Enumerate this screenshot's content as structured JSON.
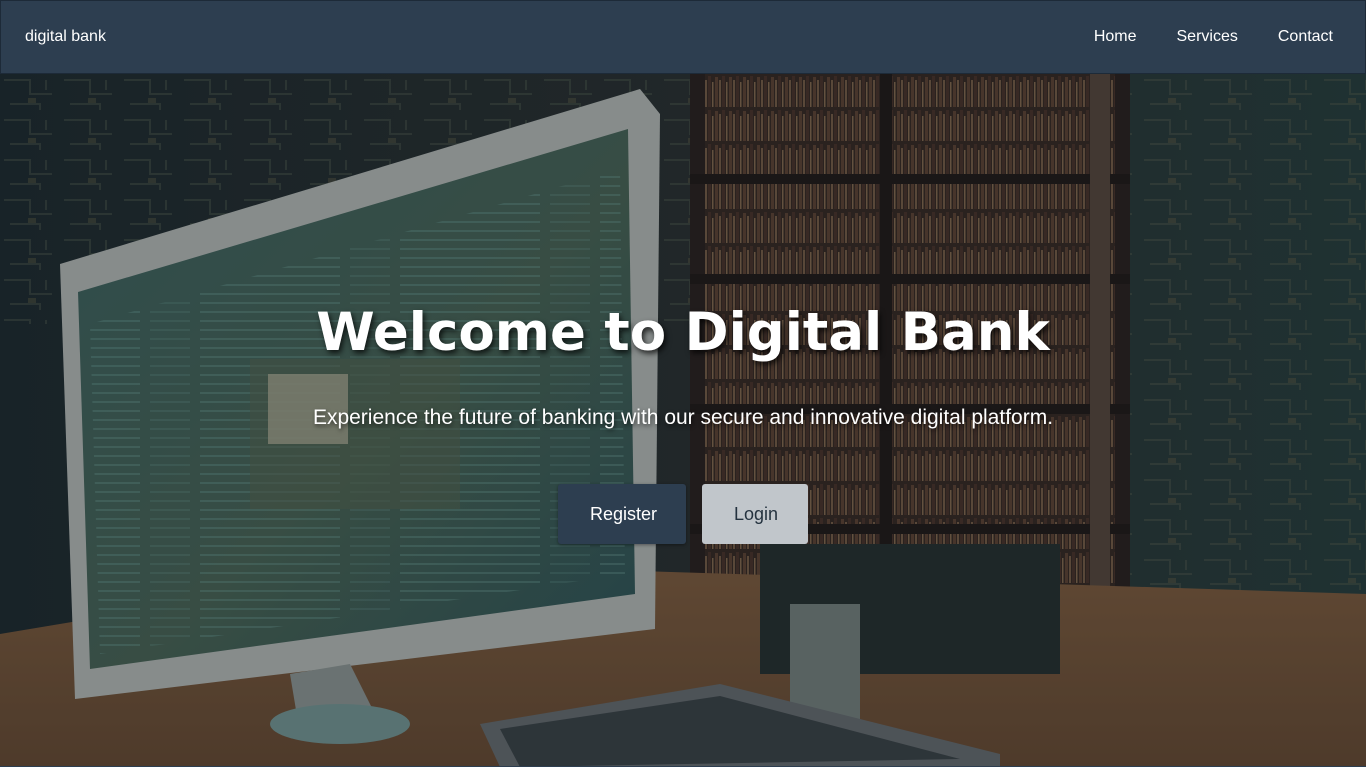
{
  "navbar": {
    "brand": "digital bank",
    "links": [
      {
        "label": "Home"
      },
      {
        "label": "Services"
      },
      {
        "label": "Contact"
      }
    ]
  },
  "hero": {
    "title": "Welcome to Digital Bank",
    "subtitle": "Experience the future of banking with our secure and innovative digital platform.",
    "register_label": "Register",
    "login_label": "Login",
    "background_image": "illustration of a desktop computer monitor and keyboard on a desk in front of a wall of bookshelves and circuit patterns"
  },
  "colors": {
    "navbar": "#2d3e50",
    "register_button": "#2d3e50",
    "login_button": "#c1c6cb",
    "text": "#ffffff"
  }
}
